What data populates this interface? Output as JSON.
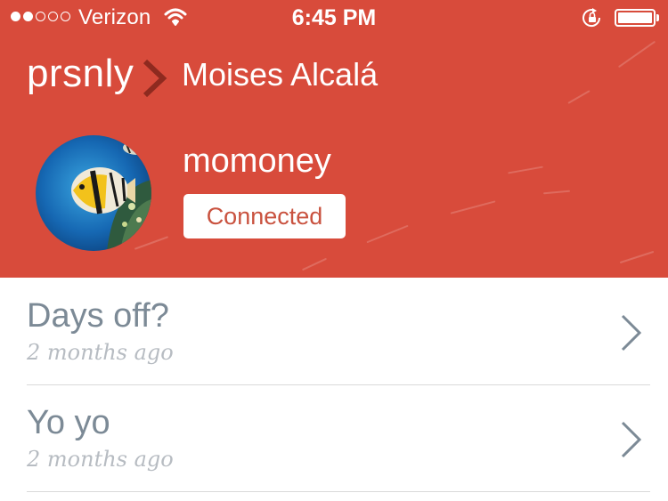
{
  "status_bar": {
    "signal_bars_filled": 2,
    "signal_bars_total": 5,
    "carrier": "Verizon",
    "time": "6:45 PM",
    "battery_level": 1.0
  },
  "header": {
    "brand": "prsnly",
    "breadcrumb_title": "Moises Alcalá",
    "username": "momoney",
    "connection_status": "Connected",
    "background_color": "#d84b3b"
  },
  "conversations": [
    {
      "title": "Days off?",
      "time_ago": "2 months ago"
    },
    {
      "title": "Yo yo",
      "time_ago": "2 months ago"
    }
  ],
  "icons": {
    "signal": "signal-dots-icon",
    "wifi": "wifi-icon",
    "rotation_lock": "rotation-lock-icon",
    "battery": "battery-icon",
    "breadcrumb": "chevron-right-icon",
    "row": "chevron-right-icon"
  }
}
